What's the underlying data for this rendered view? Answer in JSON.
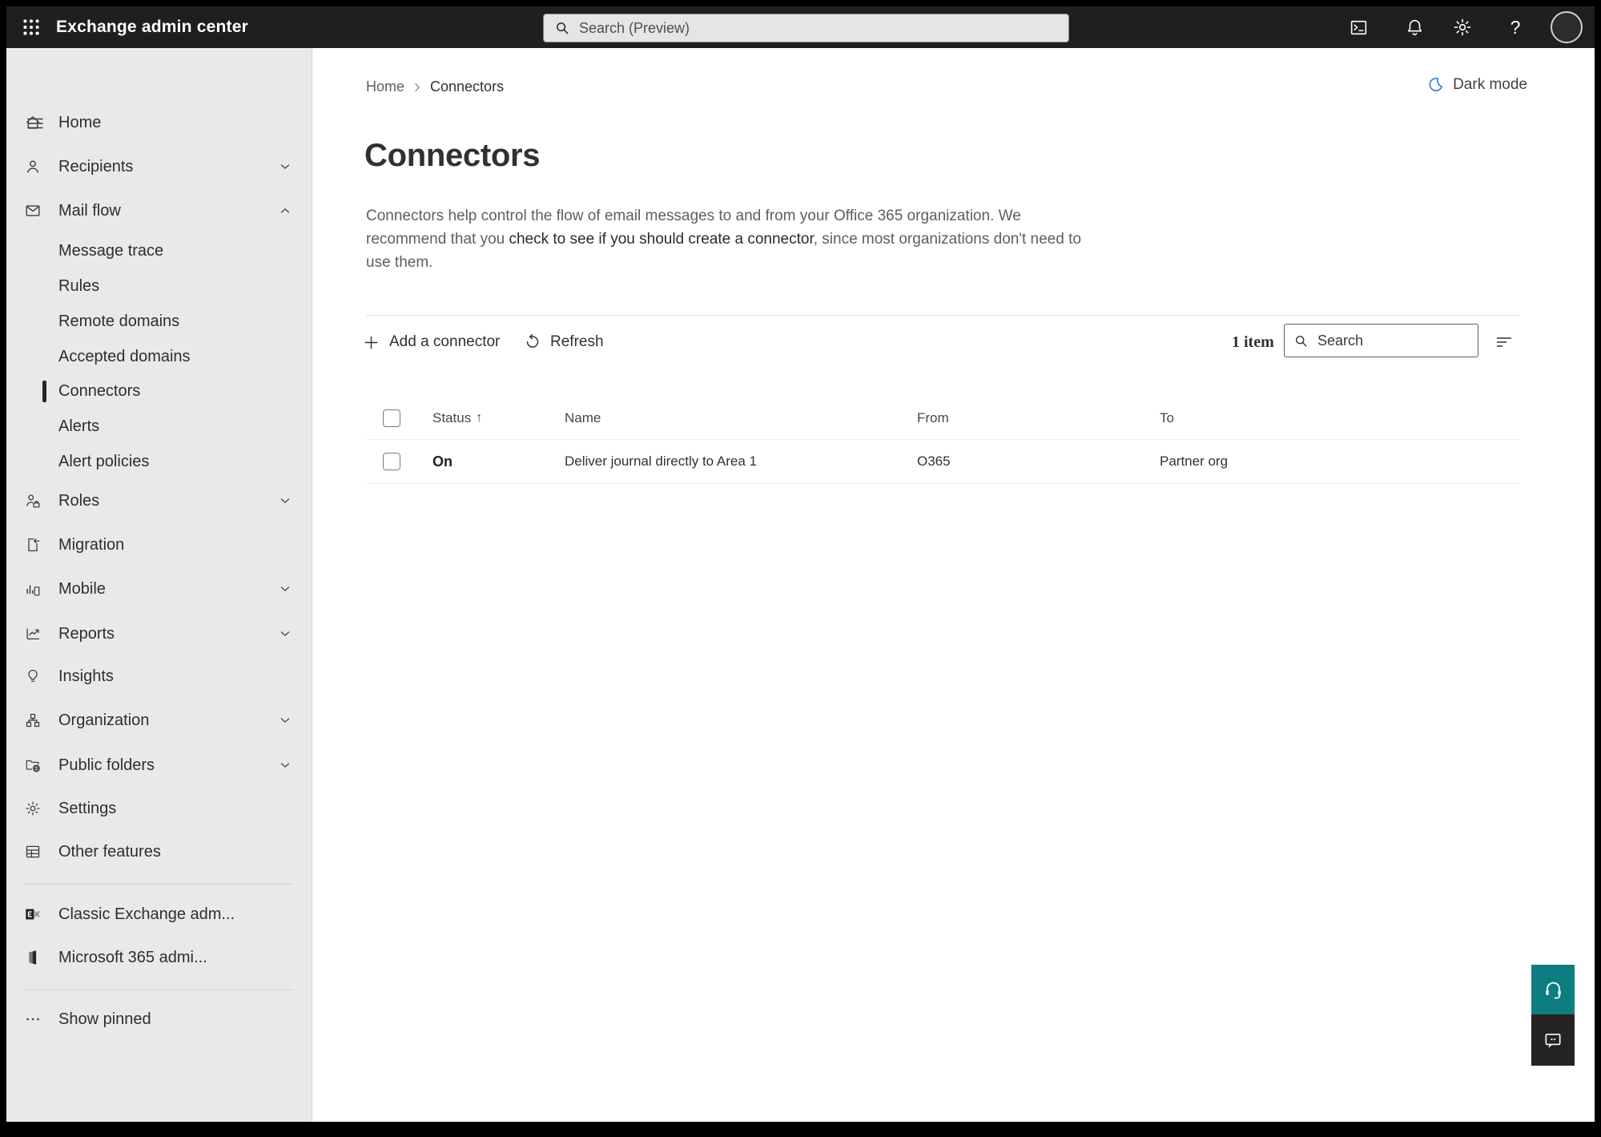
{
  "topbar": {
    "app_title": "Exchange admin center",
    "search_placeholder": "Search (Preview)",
    "help_glyph": "?"
  },
  "sidebar": {
    "top_items": [
      {
        "label": "Home"
      },
      {
        "label": "Recipients"
      },
      {
        "label": "Mail flow"
      }
    ],
    "mail_flow_children": [
      {
        "label": "Message trace"
      },
      {
        "label": "Rules"
      },
      {
        "label": "Remote domains"
      },
      {
        "label": "Accepted domains"
      },
      {
        "label": "Connectors",
        "selected": true
      },
      {
        "label": "Alerts"
      },
      {
        "label": "Alert policies"
      }
    ],
    "mid_items": [
      {
        "label": "Roles"
      },
      {
        "label": "Migration"
      },
      {
        "label": "Mobile"
      },
      {
        "label": "Reports"
      },
      {
        "label": "Insights"
      },
      {
        "label": "Organization"
      },
      {
        "label": "Public folders"
      },
      {
        "label": "Settings"
      },
      {
        "label": "Other features"
      }
    ],
    "footer_items": [
      {
        "label": "Classic Exchange adm..."
      },
      {
        "label": "Microsoft 365 admi..."
      }
    ],
    "show_pinned": "Show pinned"
  },
  "main": {
    "breadcrumb": {
      "home": "Home",
      "current": "Connectors"
    },
    "dark_mode_label": "Dark mode",
    "title": "Connectors",
    "description": {
      "part1": "Connectors help control the flow of email messages to and from your Office 365 organization. We recommend that you ",
      "link": "check to see if you should create a connector",
      "part2": ", since most organizations don't need to use them."
    },
    "toolbar": {
      "add_label": "Add a connector",
      "refresh_label": "Refresh",
      "count": "1 item",
      "search_placeholder": "Search"
    },
    "table": {
      "headers": {
        "status": "Status",
        "name": "Name",
        "from": "From",
        "to": "To"
      },
      "sort_arrow": "↑",
      "rows": [
        {
          "status": "On",
          "name": "Deliver journal directly to Area 1",
          "from": "O365",
          "to": "Partner org"
        }
      ]
    }
  },
  "colors": {
    "topbar_bg": "#1f1f1f",
    "sidebar_bg": "#e9e9e9",
    "help_button_teal": "#0e7d82",
    "dark_mode_moon_blue": "#2b7cd3"
  }
}
